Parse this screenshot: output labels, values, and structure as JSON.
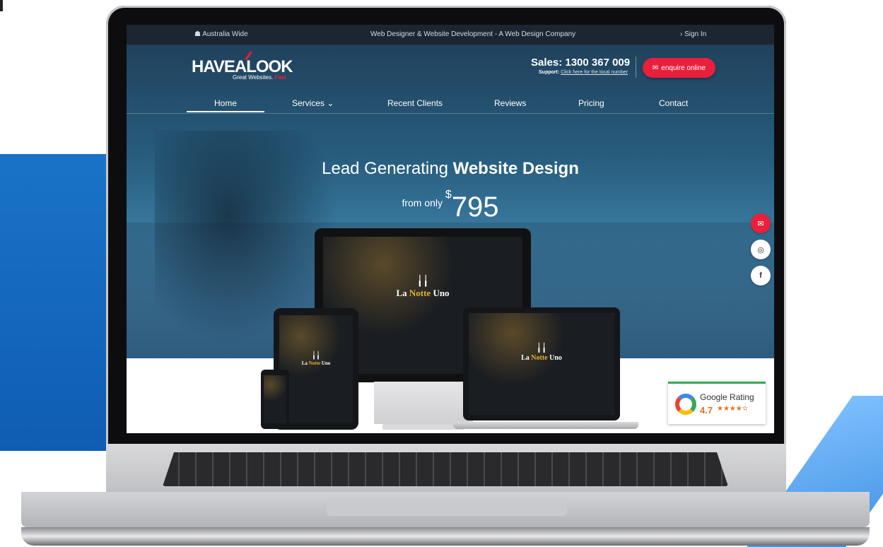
{
  "topbar": {
    "location_icon": "map-icon",
    "location": "Australia Wide",
    "tagline": "Web Designer & Website Development - A Web Design Company",
    "signin_icon": "chevron-right-icon",
    "signin": "Sign In"
  },
  "header": {
    "logo_text": "HAVEALOOK",
    "logo_tagline": "Great Websites. ",
    "logo_tagline_accent": "Fast",
    "sales": "Sales: 1300 367 009",
    "support_label": "Support:",
    "support_link": "Click here for the local number",
    "enquire_icon": "envelope-icon",
    "enquire": "enquire online"
  },
  "nav": {
    "items": [
      "Home",
      "Services",
      "Recent Clients",
      "Reviews",
      "Pricing",
      "Contact"
    ],
    "active": "Home",
    "services_icon": "chevron-down-icon"
  },
  "hero": {
    "headline_light": "Lead Generating ",
    "headline_bold": "Website Design",
    "from": "from only ",
    "currency": "$",
    "price": "795"
  },
  "mockup": {
    "brand_la": "La ",
    "brand_notte": "Notte",
    "brand_uno": " Uno"
  },
  "social": [
    {
      "icon": "envelope-icon",
      "color": "#e8203b"
    },
    {
      "icon": "instagram-icon",
      "color": "#ffffff"
    },
    {
      "icon": "facebook-icon",
      "color": "#ffffff"
    }
  ],
  "google_rating": {
    "icon": "google-logo-icon",
    "title": "Google Rating",
    "score": "4.7",
    "stars": "★★★★✫"
  }
}
